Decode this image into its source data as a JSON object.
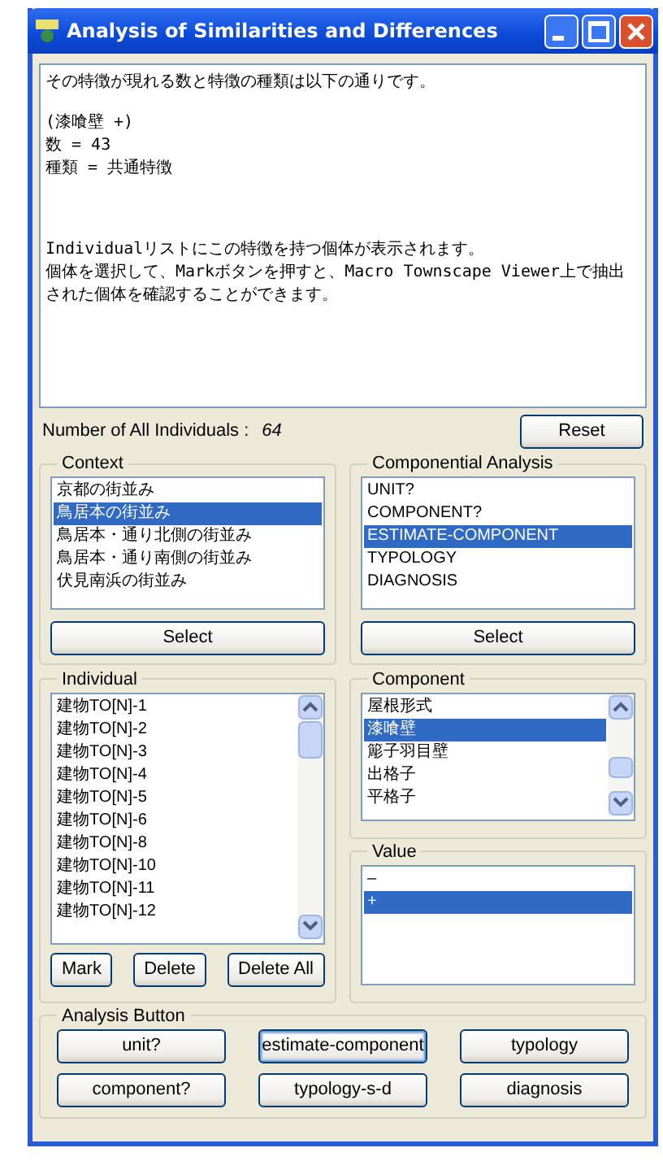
{
  "window": {
    "title": "Analysis of Similarities and Differences"
  },
  "message": {
    "paragraphs": [
      [
        "その特徴が現れる数と特徴の種類は以下の通りです。"
      ],
      [
        "(漆喰壁 +)",
        "数 = 43",
        "種類 = 共通特徴"
      ],
      [
        "Individualリストにこの特徴を持つ個体が表示されます。",
        "個体を選択して、Markボタンを押すと、Macro Townscape Viewer上で抽出された個体を確認することができます。"
      ]
    ]
  },
  "count": {
    "label": "Number of All Individuals :",
    "value": "64"
  },
  "reset_button": "Reset",
  "context": {
    "title": "Context",
    "items": [
      {
        "label": "京都の街並み",
        "selected": false
      },
      {
        "label": "鳥居本の街並み",
        "selected": true
      },
      {
        "label": "鳥居本・通り北側の街並み",
        "selected": false
      },
      {
        "label": "鳥居本・通り南側の街並み",
        "selected": false
      },
      {
        "label": "伏見南浜の街並み",
        "selected": false
      }
    ],
    "button": "Select"
  },
  "componential_analysis": {
    "title": "Componential Analysis",
    "items": [
      {
        "label": "UNIT?",
        "selected": false
      },
      {
        "label": "COMPONENT?",
        "selected": false
      },
      {
        "label": "ESTIMATE-COMPONENT",
        "selected": true
      },
      {
        "label": "TYPOLOGY",
        "selected": false
      },
      {
        "label": "DIAGNOSIS",
        "selected": false
      }
    ],
    "button": "Select"
  },
  "individual": {
    "title": "Individual",
    "items": [
      {
        "label": "建物TO[N]-1",
        "selected": false
      },
      {
        "label": "建物TO[N]-2",
        "selected": false
      },
      {
        "label": "建物TO[N]-3",
        "selected": false
      },
      {
        "label": "建物TO[N]-4",
        "selected": false
      },
      {
        "label": "建物TO[N]-5",
        "selected": false
      },
      {
        "label": "建物TO[N]-6",
        "selected": false
      },
      {
        "label": "建物TO[N]-8",
        "selected": false
      },
      {
        "label": "建物TO[N]-10",
        "selected": false
      },
      {
        "label": "建物TO[N]-11",
        "selected": false
      },
      {
        "label": "建物TO[N]-12",
        "selected": false
      }
    ],
    "buttons": [
      "Mark",
      "Delete",
      "Delete All"
    ]
  },
  "component": {
    "title": "Component",
    "items": [
      {
        "label": "屋根形式",
        "selected": false
      },
      {
        "label": "漆喰壁",
        "selected": true
      },
      {
        "label": "簓子羽目壁",
        "selected": false
      },
      {
        "label": "出格子",
        "selected": false
      },
      {
        "label": "平格子",
        "selected": false
      }
    ]
  },
  "value": {
    "title": "Value",
    "items": [
      {
        "label": "–",
        "selected": false
      },
      {
        "label": "+",
        "selected": true
      }
    ]
  },
  "analysis_buttons": {
    "title": "Analysis Button",
    "buttons": [
      {
        "label": "unit?",
        "focused": false
      },
      {
        "label": "estimate-component",
        "focused": true
      },
      {
        "label": "typology",
        "focused": false
      },
      {
        "label": "component?",
        "focused": false
      },
      {
        "label": "typology-s-d",
        "focused": false
      },
      {
        "label": "diagnosis",
        "focused": false
      }
    ]
  }
}
